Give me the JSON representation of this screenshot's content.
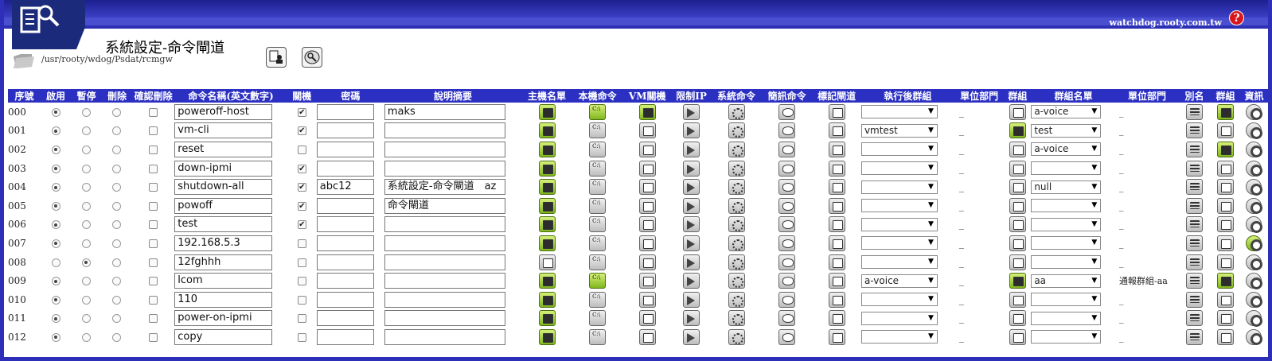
{
  "header": {
    "host": "watchdog.rooty.com.tw",
    "help_label": "?",
    "title": "系統設定-命令閘道",
    "path": "/usr/rooty/wdog/Psdat/rcmgw"
  },
  "columns": [
    "序號",
    "啟用",
    "暫停",
    "刪除",
    "確認刪除",
    "命令名稱(英文數字)",
    "關機",
    "密碼",
    "說明摘要",
    "主機名單",
    "本機命令",
    "VM關機",
    "限制IP",
    "系統命令",
    "簡訊命令",
    "標記閘道",
    "執行後群組",
    "單位部門",
    "群組",
    "群組名單",
    "單位部門",
    "別名",
    "群組",
    "資訊"
  ],
  "rows": [
    {
      "seq": "000",
      "enabled": true,
      "paused": false,
      "name": "poweroff-host",
      "shutdown": true,
      "password": "",
      "desc": "maks",
      "host_green": true,
      "cli_green": true,
      "vm_green": true,
      "after_group": "",
      "dept1": "_",
      "group1_green": false,
      "group_list": "a-voice",
      "dept2": "_",
      "group2_green": true,
      "info_green": false
    },
    {
      "seq": "001",
      "enabled": true,
      "paused": false,
      "name": "vm-cli",
      "shutdown": true,
      "password": "",
      "desc": "",
      "host_green": true,
      "cli_green": false,
      "vm_green": false,
      "after_group": "vmtest",
      "dept1": "_",
      "group1_green": true,
      "group_list": "test",
      "dept2": "_",
      "group2_green": false,
      "info_green": false
    },
    {
      "seq": "002",
      "enabled": true,
      "paused": false,
      "name": "reset",
      "shutdown": false,
      "password": "",
      "desc": "",
      "host_green": true,
      "cli_green": false,
      "vm_green": false,
      "after_group": "",
      "dept1": "_",
      "group1_green": false,
      "group_list": "a-voice",
      "dept2": "_",
      "group2_green": true,
      "info_green": false
    },
    {
      "seq": "003",
      "enabled": true,
      "paused": false,
      "name": "down-ipmi",
      "shutdown": true,
      "password": "",
      "desc": "",
      "host_green": true,
      "cli_green": false,
      "vm_green": false,
      "after_group": "",
      "dept1": "_",
      "group1_green": false,
      "group_list": "",
      "dept2": "_",
      "group2_green": false,
      "info_green": false
    },
    {
      "seq": "004",
      "enabled": true,
      "paused": false,
      "name": "shutdown-all",
      "shutdown": true,
      "password": "abc12",
      "desc": "系統設定-命令閘道　az",
      "host_green": true,
      "cli_green": false,
      "vm_green": false,
      "after_group": "",
      "dept1": "_",
      "group1_green": false,
      "group_list": "null",
      "dept2": "_",
      "group2_green": false,
      "info_green": false
    },
    {
      "seq": "005",
      "enabled": true,
      "paused": false,
      "name": "powoff",
      "shutdown": true,
      "password": "",
      "desc": "命令閘道",
      "host_green": true,
      "cli_green": false,
      "vm_green": false,
      "after_group": "",
      "dept1": "_",
      "group1_green": false,
      "group_list": "",
      "dept2": "_",
      "group2_green": false,
      "info_green": false
    },
    {
      "seq": "006",
      "enabled": true,
      "paused": false,
      "name": "test",
      "shutdown": true,
      "password": "",
      "desc": "",
      "host_green": true,
      "cli_green": false,
      "vm_green": false,
      "after_group": "",
      "dept1": "_",
      "group1_green": false,
      "group_list": "",
      "dept2": "_",
      "group2_green": false,
      "info_green": false
    },
    {
      "seq": "007",
      "enabled": true,
      "paused": false,
      "name": "192.168.5.3",
      "shutdown": false,
      "password": "",
      "desc": "",
      "host_green": true,
      "cli_green": false,
      "vm_green": false,
      "after_group": "",
      "dept1": "_",
      "group1_green": false,
      "group_list": "",
      "dept2": "_",
      "group2_green": false,
      "info_green": true
    },
    {
      "seq": "008",
      "enabled": false,
      "paused": true,
      "name": "12fghhh",
      "shutdown": false,
      "password": "",
      "desc": "",
      "host_green": false,
      "cli_green": false,
      "vm_green": false,
      "after_group": "",
      "dept1": "_",
      "group1_green": false,
      "group_list": "",
      "dept2": "_",
      "group2_green": false,
      "info_green": false
    },
    {
      "seq": "009",
      "enabled": true,
      "paused": false,
      "name": "lcom",
      "shutdown": false,
      "password": "",
      "desc": "",
      "host_green": true,
      "cli_green": true,
      "vm_green": false,
      "after_group": "a-voice",
      "dept1": "_",
      "group1_green": true,
      "group_list": "aa",
      "dept2": "通報群組-aa",
      "group2_green": true,
      "info_green": false
    },
    {
      "seq": "010",
      "enabled": true,
      "paused": false,
      "name": "110",
      "shutdown": false,
      "password": "",
      "desc": "",
      "host_green": true,
      "cli_green": false,
      "vm_green": false,
      "after_group": "",
      "dept1": "_",
      "group1_green": false,
      "group_list": "",
      "dept2": "_",
      "group2_green": false,
      "info_green": false
    },
    {
      "seq": "011",
      "enabled": true,
      "paused": false,
      "name": "power-on-ipmi",
      "shutdown": false,
      "password": "",
      "desc": "",
      "host_green": true,
      "cli_green": false,
      "vm_green": false,
      "after_group": "",
      "dept1": "_",
      "group1_green": false,
      "group_list": "",
      "dept2": "_",
      "group2_green": false,
      "info_green": false
    },
    {
      "seq": "012",
      "enabled": true,
      "paused": false,
      "name": "copy",
      "shutdown": false,
      "password": "",
      "desc": "",
      "host_green": true,
      "cli_green": false,
      "vm_green": false,
      "after_group": "",
      "dept1": "_",
      "group1_green": false,
      "group_list": "",
      "dept2": "_",
      "group2_green": false,
      "info_green": false
    }
  ],
  "colors": {
    "header_blue": "#2b2fc2",
    "frame_blue": "#2d2fb8",
    "icon_green": "#7fb61d"
  }
}
